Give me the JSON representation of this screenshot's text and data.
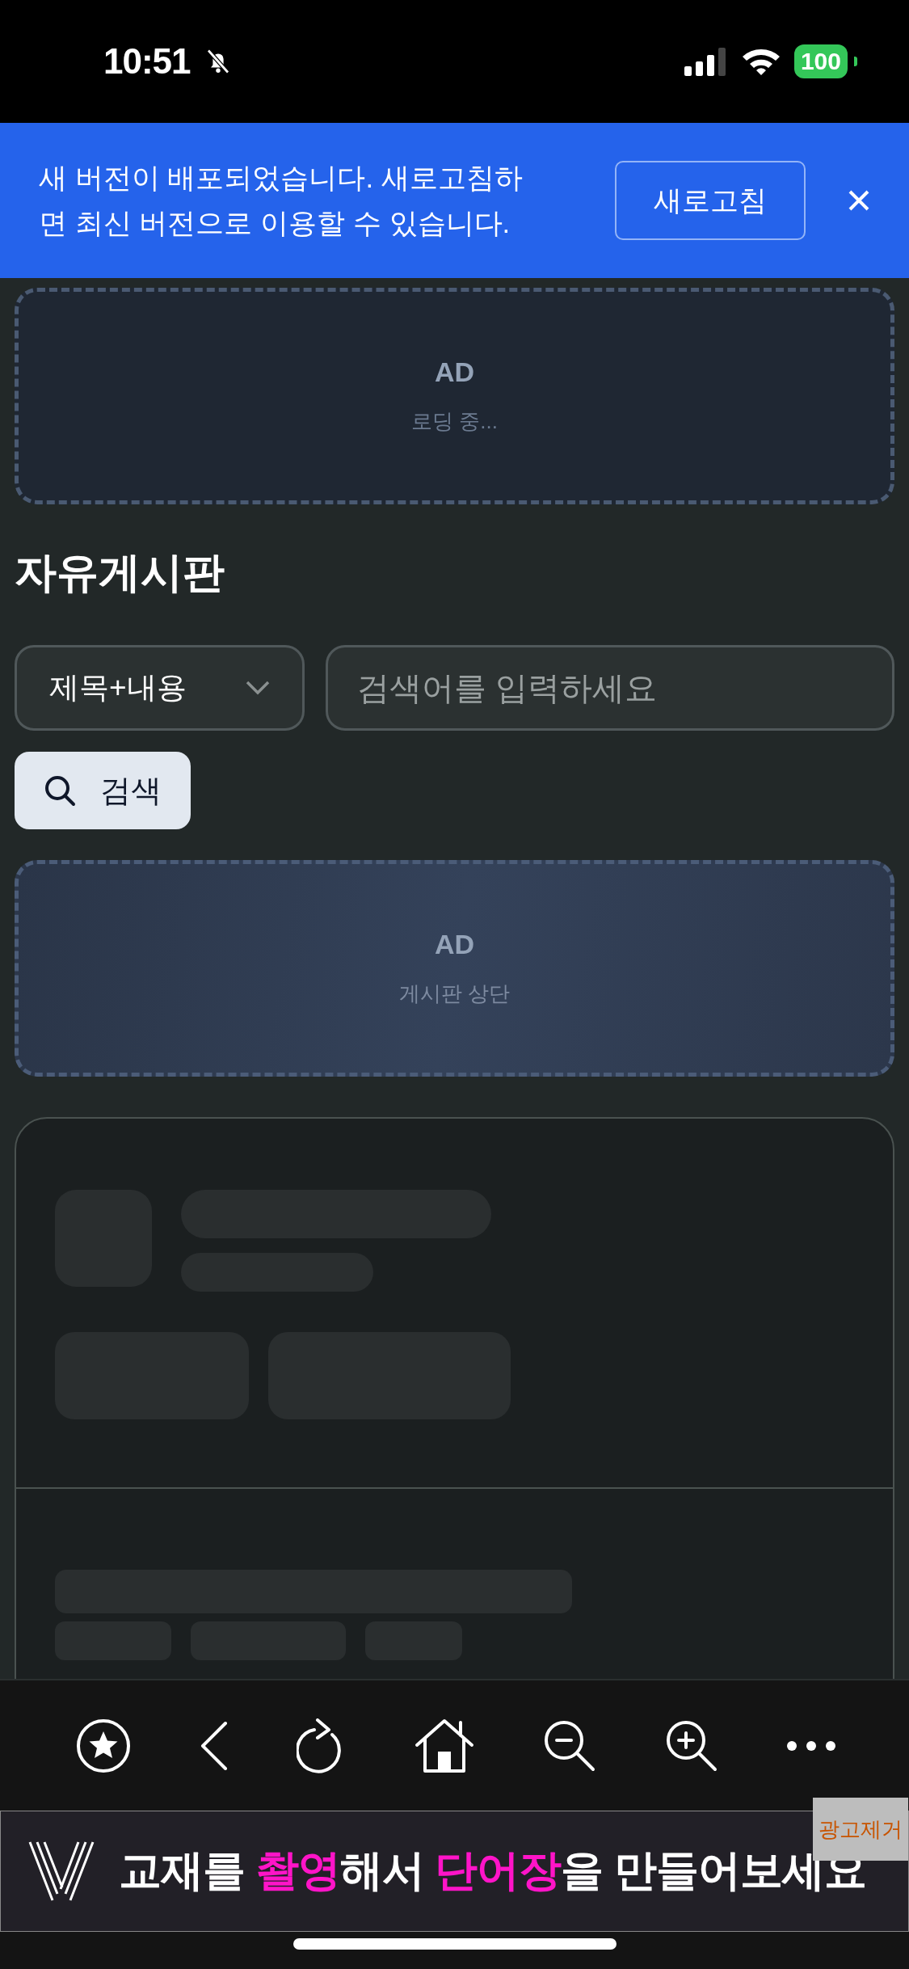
{
  "status_bar": {
    "time": "10:51",
    "silent": true,
    "battery": "100"
  },
  "update_banner": {
    "message": "새 버전이 배포되었습니다. 새로고침하면 최신 버전으로 이용할 수 있습니다.",
    "button": "새로고침"
  },
  "ad_top": {
    "label": "AD",
    "status": "로딩 중..."
  },
  "board": {
    "title": "자유게시판",
    "filter": {
      "value": "제목+내용"
    },
    "search": {
      "placeholder": "검색어를 입력하세요"
    },
    "search_button": "검색"
  },
  "ad_board": {
    "label": "AD",
    "status": "게시판 상단"
  },
  "bottom_ad": {
    "segments": [
      {
        "text": "교재를 ",
        "highlight": false
      },
      {
        "text": "촬영",
        "highlight": true
      },
      {
        "text": "해서 ",
        "highlight": false
      },
      {
        "text": "단어장",
        "highlight": true
      },
      {
        "text": "을 만들어보세요",
        "highlight": false
      }
    ],
    "remove_label": "광고제거"
  }
}
